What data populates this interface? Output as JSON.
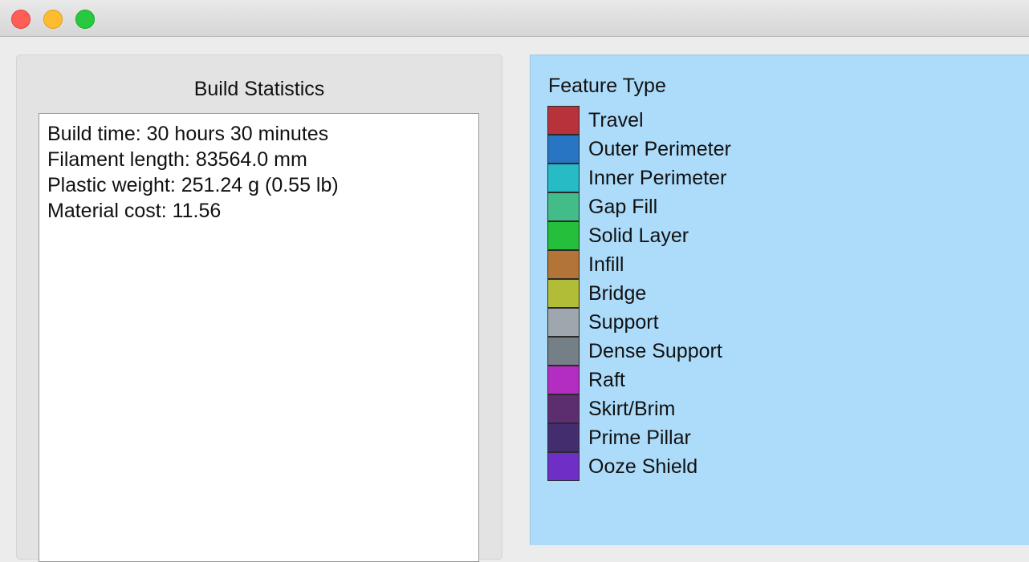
{
  "window": {
    "controls": {
      "close": "close-button",
      "minimize": "minimize-button",
      "maximize": "maximize-button"
    }
  },
  "build_statistics": {
    "title": "Build Statistics",
    "lines": [
      "Build time: 30 hours 30 minutes",
      "Filament length: 83564.0 mm",
      "Plastic weight: 251.24 g (0.55 lb)",
      "Material cost: 11.56"
    ]
  },
  "feature_type": {
    "title": "Feature Type",
    "items": [
      {
        "label": "Travel",
        "color": "#b7323a"
      },
      {
        "label": "Outer Perimeter",
        "color": "#2775c3"
      },
      {
        "label": "Inner Perimeter",
        "color": "#27bbc6"
      },
      {
        "label": "Gap Fill",
        "color": "#42bd8a"
      },
      {
        "label": "Solid Layer",
        "color": "#25bf3c"
      },
      {
        "label": "Infill",
        "color": "#b37438"
      },
      {
        "label": "Bridge",
        "color": "#b2bd37"
      },
      {
        "label": "Support",
        "color": "#9fa7ae"
      },
      {
        "label": "Dense Support",
        "color": "#757f86"
      },
      {
        "label": "Raft",
        "color": "#b32dc3"
      },
      {
        "label": "Skirt/Brim",
        "color": "#5d2e6f"
      },
      {
        "label": "Prime Pillar",
        "color": "#432d6f"
      },
      {
        "label": "Ooze Shield",
        "color": "#6f2fc6"
      }
    ]
  }
}
